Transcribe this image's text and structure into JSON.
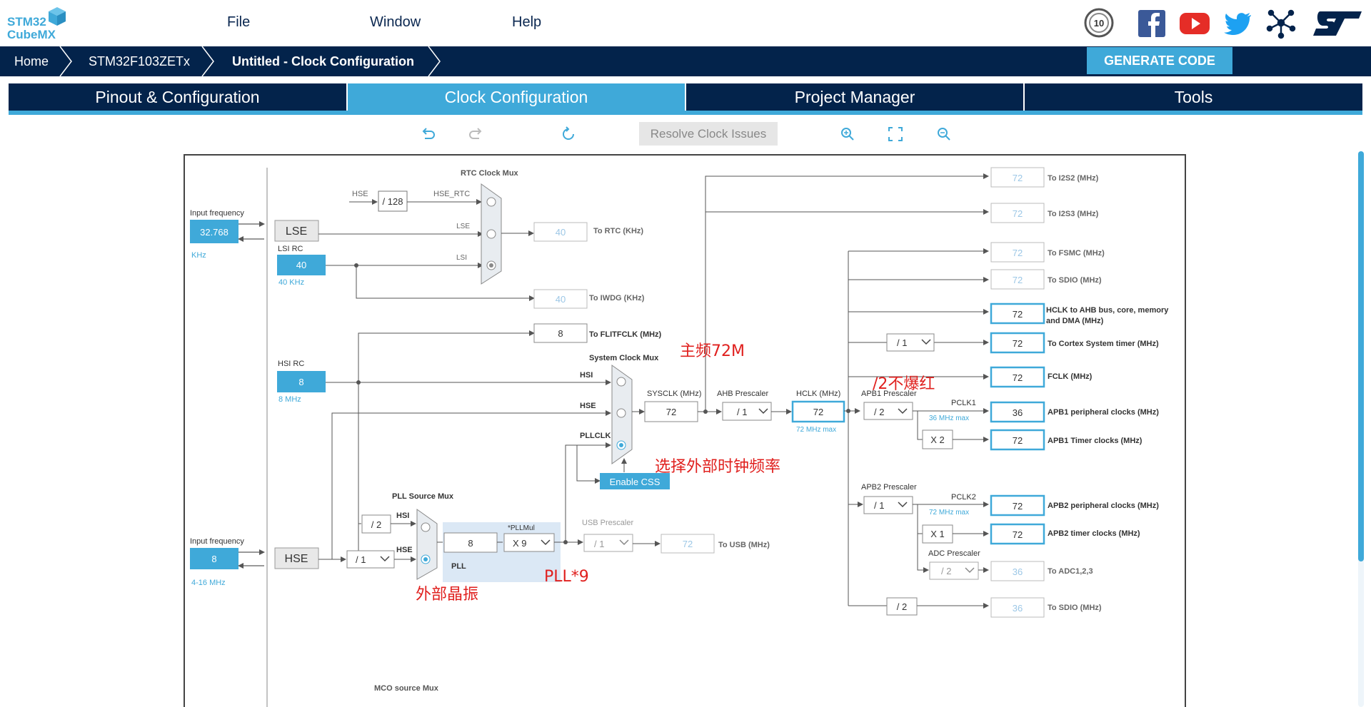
{
  "app": {
    "logo_line1": "STM32",
    "logo_line2": "CubeMX"
  },
  "menu": {
    "file": "File",
    "window": "Window",
    "help": "Help"
  },
  "social": {
    "icons": [
      "anniversary-badge-icon",
      "facebook-icon",
      "youtube-icon",
      "twitter-icon",
      "network-icon",
      "st-logo-icon"
    ],
    "badge_text": "10"
  },
  "breadcrumb": {
    "home": "Home",
    "device": "STM32F103ZETx",
    "current": "Untitled - Clock Configuration"
  },
  "generate_button": "GENERATE CODE",
  "tabs": [
    "Pinout & Configuration",
    "Clock Configuration",
    "Project Manager",
    "Tools"
  ],
  "toolbar": {
    "resolve": "Resolve Clock Issues",
    "icons": [
      "undo-icon",
      "redo-icon",
      "refresh-icon",
      "zoom-in-icon",
      "fit-icon",
      "zoom-out-icon"
    ]
  },
  "colors": {
    "navy": "#03234b",
    "accent": "#3fa9d9",
    "annotation": "#e0201e"
  },
  "clock": {
    "input_freq_label": "Input frequency",
    "lse_input": "32.768",
    "lse_unit": "KHz",
    "lse": "LSE",
    "lsi_rc": "LSI RC",
    "lsi_value": "40",
    "lsi_unit": "40 KHz",
    "hsi_rc": "HSI RC",
    "hsi_value": "8",
    "hsi_unit": "8 MHz",
    "hse_input": "8",
    "hse_unit": "4-16 MHz",
    "hse": "HSE",
    "rtc_mux_title": "RTC Clock Mux",
    "rtc_hse": "HSE",
    "rtc_div": "/ 128",
    "rtc_hse_rtc": "HSE_RTC",
    "rtc_lse": "LSE",
    "rtc_lsi": "LSI",
    "rtc_out": "40",
    "rtc_out_label": "To RTC (KHz)",
    "iwdg_out": "40",
    "iwdg_label": "To IWDG (KHz)",
    "flit_out": "8",
    "flit_label": "To FLITFCLK (MHz)",
    "sys_mux_title": "System Clock Mux",
    "sys_hsi": "HSI",
    "sys_hse": "HSE",
    "sys_pllclk": "PLLCLK",
    "sysclk_label": "SYSCLK (MHz)",
    "sysclk": "72",
    "ahb_label": "AHB Prescaler",
    "ahb": "/ 1",
    "hclk_label": "HCLK (MHz)",
    "hclk": "72",
    "hclk_max": "72 MHz max",
    "enable_css": "Enable CSS",
    "pll_mux_title": "PLL Source Mux",
    "pll_hsi_div": "/ 2",
    "pll_hsi": "HSI",
    "pll_hse": "HSE",
    "hse_div": "/ 1",
    "pll_value": "8",
    "pllmul_label": "*PLLMul",
    "pllmul": "X 9",
    "pll_label": "PLL",
    "usb_label": "USB Prescaler",
    "usb_div": "/ 1",
    "usb_out": "72",
    "usb_out_label": "To USB (MHz)",
    "apb1_label": "APB1 Prescaler",
    "apb1": "/ 2",
    "pclk1": "PCLK1",
    "pclk1_max": "36 MHz max",
    "apb1_timer_mul": "X 2",
    "apb2_label": "APB2 Prescaler",
    "apb2": "/ 1",
    "pclk2": "PCLK2",
    "pclk2_max": "72 MHz max",
    "apb2_timer_mul": "X 1",
    "adc_label": "ADC Prescaler",
    "adc": "/ 2",
    "cortex_div": "/ 1",
    "sdio_div": "/ 2",
    "mco_label": "MCO source Mux",
    "outputs": [
      {
        "value": "72",
        "label": "To I2S2 (MHz)",
        "active": false
      },
      {
        "value": "72",
        "label": "To I2S3 (MHz)",
        "active": false
      },
      {
        "value": "72",
        "label": "To FSMC (MHz)",
        "active": false
      },
      {
        "value": "72",
        "label": "To SDIO (MHz)",
        "active": false
      },
      {
        "value": "72",
        "label": "HCLK to AHB bus, core, memory and DMA (MHz)",
        "active": true
      },
      {
        "value": "72",
        "label": "To Cortex System timer (MHz)",
        "active": true
      },
      {
        "value": "72",
        "label": "FCLK (MHz)",
        "active": true
      },
      {
        "value": "36",
        "label": "APB1 peripheral clocks (MHz)",
        "active": true
      },
      {
        "value": "72",
        "label": "APB1 Timer clocks (MHz)",
        "active": true
      },
      {
        "value": "72",
        "label": "APB2 peripheral clocks (MHz)",
        "active": true
      },
      {
        "value": "72",
        "label": "APB2 timer clocks (MHz)",
        "active": true
      },
      {
        "value": "36",
        "label": "To ADC1,2,3",
        "active": false
      },
      {
        "value": "36",
        "label": "To SDIO (MHz)",
        "active": false
      }
    ]
  },
  "annotations": {
    "main_freq": "主频72M",
    "no_red": "/2不爆红",
    "select_ext": "选择外部时钟频率",
    "ext_crystal": "外部晶振",
    "pll9": "PLL*9"
  }
}
